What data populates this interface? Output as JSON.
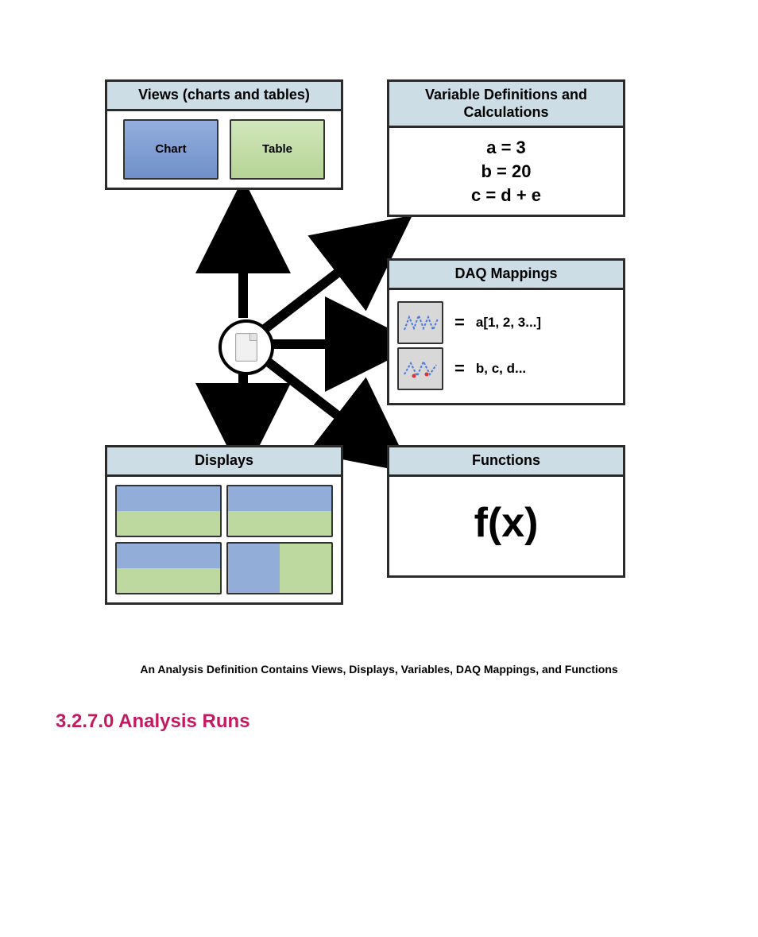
{
  "views": {
    "title": "Views (charts and tables)",
    "chart_label": "Chart",
    "table_label": "Table"
  },
  "variables": {
    "title": "Variable Definitions and Calculations",
    "line1": "a = 3",
    "line2": "b = 20",
    "line3": "c = d + e"
  },
  "daq": {
    "title": "DAQ Mappings",
    "row1_eq": "=",
    "row1_label": "a[1, 2, 3...]",
    "row2_eq": "=",
    "row2_label": "b, c, d..."
  },
  "functions": {
    "title": "Functions",
    "fx": "f(x)"
  },
  "displays": {
    "title": "Displays"
  },
  "caption": "An Analysis Definition Contains Views, Displays, Variables, DAQ Mappings, and Functions",
  "heading": "3.2.7.0 Analysis Runs"
}
